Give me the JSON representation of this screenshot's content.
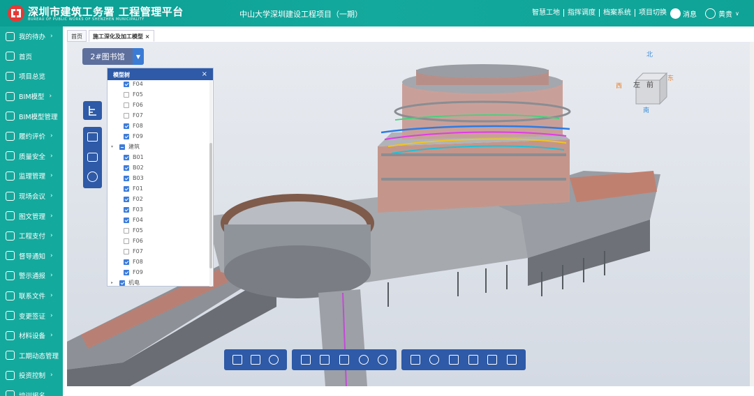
{
  "header": {
    "brand": "深圳市建筑工务署 工程管理平台",
    "brand_sub": "BUREAU OF PUBLIC WORKS OF SHENZHEN MUNICIPALITY",
    "project_title": "中山大学深圳建设工程项目（一期）",
    "nav": [
      "智慧工地",
      "指挥调度",
      "档案系统",
      "项目切换"
    ],
    "message_label": "消息",
    "user_name": "黄贵",
    "accent_color": "#14a99d"
  },
  "sidebar": {
    "items": [
      {
        "label": "我的待办",
        "icon": "todo-icon",
        "arrow": true
      },
      {
        "label": "首页",
        "icon": "home-icon",
        "arrow": false
      },
      {
        "label": "项目总览",
        "icon": "overview-icon",
        "arrow": false
      },
      {
        "label": "BIM模型",
        "icon": "bim-icon",
        "arrow": true
      },
      {
        "label": "BIM模型管理",
        "icon": "cube-icon",
        "arrow": false
      },
      {
        "label": "履约评价",
        "icon": "evaluation-icon",
        "arrow": true
      },
      {
        "label": "质量安全",
        "icon": "safety-icon",
        "arrow": true
      },
      {
        "label": "监理管理",
        "icon": "supervision-icon",
        "arrow": true
      },
      {
        "label": "现场会议",
        "icon": "meeting-icon",
        "arrow": true
      },
      {
        "label": "图文管理",
        "icon": "image-icon",
        "arrow": true
      },
      {
        "label": "工程支付",
        "icon": "payment-icon",
        "arrow": true
      },
      {
        "label": "督导通知",
        "icon": "notice-icon",
        "arrow": true
      },
      {
        "label": "警示通报",
        "icon": "warning-icon",
        "arrow": true
      },
      {
        "label": "联系文件",
        "icon": "file-icon",
        "arrow": true
      },
      {
        "label": "变更签证",
        "icon": "change-icon",
        "arrow": true
      },
      {
        "label": "材料设备",
        "icon": "material-icon",
        "arrow": true
      },
      {
        "label": "工期动态管理",
        "icon": "schedule-icon",
        "arrow": false
      },
      {
        "label": "投资控制",
        "icon": "yen-icon",
        "arrow": true
      },
      {
        "label": "培训报名",
        "icon": "training-icon",
        "arrow": false
      }
    ]
  },
  "tabs": [
    {
      "label": "首页",
      "active": false
    },
    {
      "label": "施工深化及加工模型",
      "active": true,
      "close": "×"
    }
  ],
  "viewer": {
    "building_select": "2#图书馆",
    "tree_title": "模型树",
    "tree_close": "×",
    "tree_rows": [
      {
        "label": "F04",
        "checked": true,
        "level": 2
      },
      {
        "label": "F05",
        "checked": false,
        "level": 2
      },
      {
        "label": "F06",
        "checked": false,
        "level": 2
      },
      {
        "label": "F07",
        "checked": false,
        "level": 2
      },
      {
        "label": "F08",
        "checked": true,
        "level": 2
      },
      {
        "label": "F09",
        "checked": true,
        "level": 2
      },
      {
        "label": "建筑",
        "checked": "partial",
        "level": 1,
        "expanded": true
      },
      {
        "label": "B01",
        "checked": true,
        "level": 2
      },
      {
        "label": "B02",
        "checked": true,
        "level": 2
      },
      {
        "label": "B03",
        "checked": true,
        "level": 2
      },
      {
        "label": "F01",
        "checked": true,
        "level": 2
      },
      {
        "label": "F02",
        "checked": true,
        "level": 2
      },
      {
        "label": "F03",
        "checked": true,
        "level": 2
      },
      {
        "label": "F04",
        "checked": true,
        "level": 2
      },
      {
        "label": "F05",
        "checked": false,
        "level": 2
      },
      {
        "label": "F06",
        "checked": false,
        "level": 2
      },
      {
        "label": "F07",
        "checked": false,
        "level": 2
      },
      {
        "label": "F08",
        "checked": true,
        "level": 2
      },
      {
        "label": "F09",
        "checked": true,
        "level": 2
      },
      {
        "label": "机电",
        "checked": true,
        "level": 1,
        "expanded": false
      }
    ],
    "compass": {
      "north": "北",
      "south": "南",
      "east": "东",
      "west": "西",
      "face_left": "左",
      "face_front": "前"
    },
    "left_tools": [
      "tree-icon",
      "comment-icon",
      "camera-icon",
      "settings-icon"
    ],
    "bottom_toolbar_groups": [
      [
        "home-icon",
        "location-icon",
        "person-icon"
      ],
      [
        "measure-icon",
        "section-icon",
        "list-icon",
        "target-icon",
        "hide-icon"
      ],
      [
        "box-icon",
        "orbit-icon",
        "pan-hand-icon",
        "fly-icon",
        "grid-icon",
        "fullscreen-icon"
      ]
    ]
  }
}
